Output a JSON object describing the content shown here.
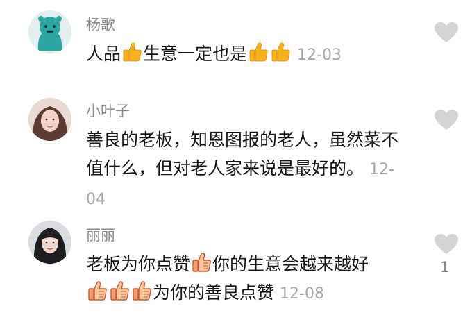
{
  "comments": [
    {
      "username": "杨歌",
      "parts": [
        "人品",
        "生意一定也是"
      ],
      "time": "12-03",
      "like_count": ""
    },
    {
      "username": "小叶子",
      "text": "善良的老板，知恩图报的老人，虽然菜不值什么，但对老人家来说是最好的。",
      "time": "12-04",
      "like_count": ""
    },
    {
      "username": "丽丽",
      "parts": [
        "老板为你点赞",
        "你的生意会越来越好",
        "为你的善良点赞"
      ],
      "time": "12-08",
      "like_count": "1"
    }
  ],
  "icons": {
    "thumbs_up_yellow": "#F7B21A",
    "thumbs_up_orange": "#F59A5C",
    "like_heart": "#D4D4D4"
  }
}
